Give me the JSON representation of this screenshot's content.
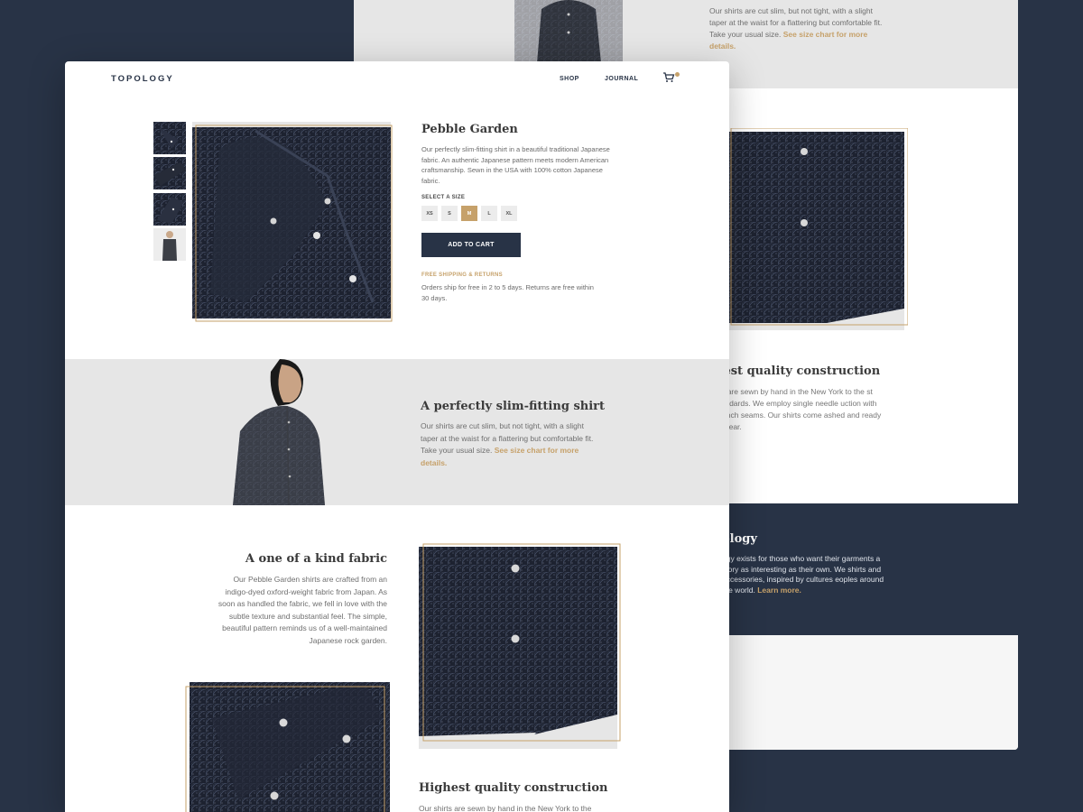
{
  "colors": {
    "background": "#283346",
    "accent": "#c6a16a",
    "dark": "#283346",
    "band": "#e6e6e6"
  },
  "header": {
    "logo": "TOPOLOGY",
    "nav": [
      "SHOP",
      "JOURNAL"
    ],
    "cart_icon": "cart-icon"
  },
  "product": {
    "title": "Pebble Garden",
    "description": "Our perfectly slim-fitting shirt in a beautiful traditional Japanese fabric. An authentic Japanese pattern meets modern American craftsmanship. Sewn in the USA with 100% cotton Japanese fabric.",
    "size_label": "SELECT A SIZE",
    "sizes": [
      "XS",
      "S",
      "M",
      "L",
      "XL"
    ],
    "selected_size": "M",
    "add_to_cart": "ADD TO CART",
    "shipping_label": "FREE SHIPPING & RETURNS",
    "shipping_text": "Orders ship for free in 2 to 5 days. Returns are free within 30 days."
  },
  "fit": {
    "title": "A perfectly slim-fitting shirt",
    "text": "Our shirts are cut slim, but not tight, with a slight taper at the waist for a flattering but comfortable fit. Take your usual size.",
    "link": "See size chart for more details."
  },
  "fabric": {
    "title": "A one of a kind fabric",
    "text": "Our Pebble Garden shirts are crafted from an indigo-dyed oxford-weight fabric from Japan. As soon as handled the fabric, we fell in love with the subtle texture and substantial feel. The simple, beautiful pattern reminds us of a well-maintained Japanese rock garden."
  },
  "construction": {
    "title": "Highest quality construction",
    "text_partial": "Our shirts are sewn by hand in the New York to the"
  },
  "background_page": {
    "top_text": "Our shirts are cut slim, but not tight, with a slight taper at the waist for a flattering but comfortable fit. Take your usual size.",
    "top_link": "See size chart for more details.",
    "construction_title": "hest quality construction",
    "construction_text": "irts are sewn by hand in the New York to the st standards. We employ single needle uction with French seams. Our shirts come ashed and ready to wear.",
    "about_title": "ology",
    "about_text": "ogy exists for those who want their garments a story as interesting as their own. We shirts and accessories, inspired by cultures eoples around the world.",
    "about_link": "Learn more."
  }
}
